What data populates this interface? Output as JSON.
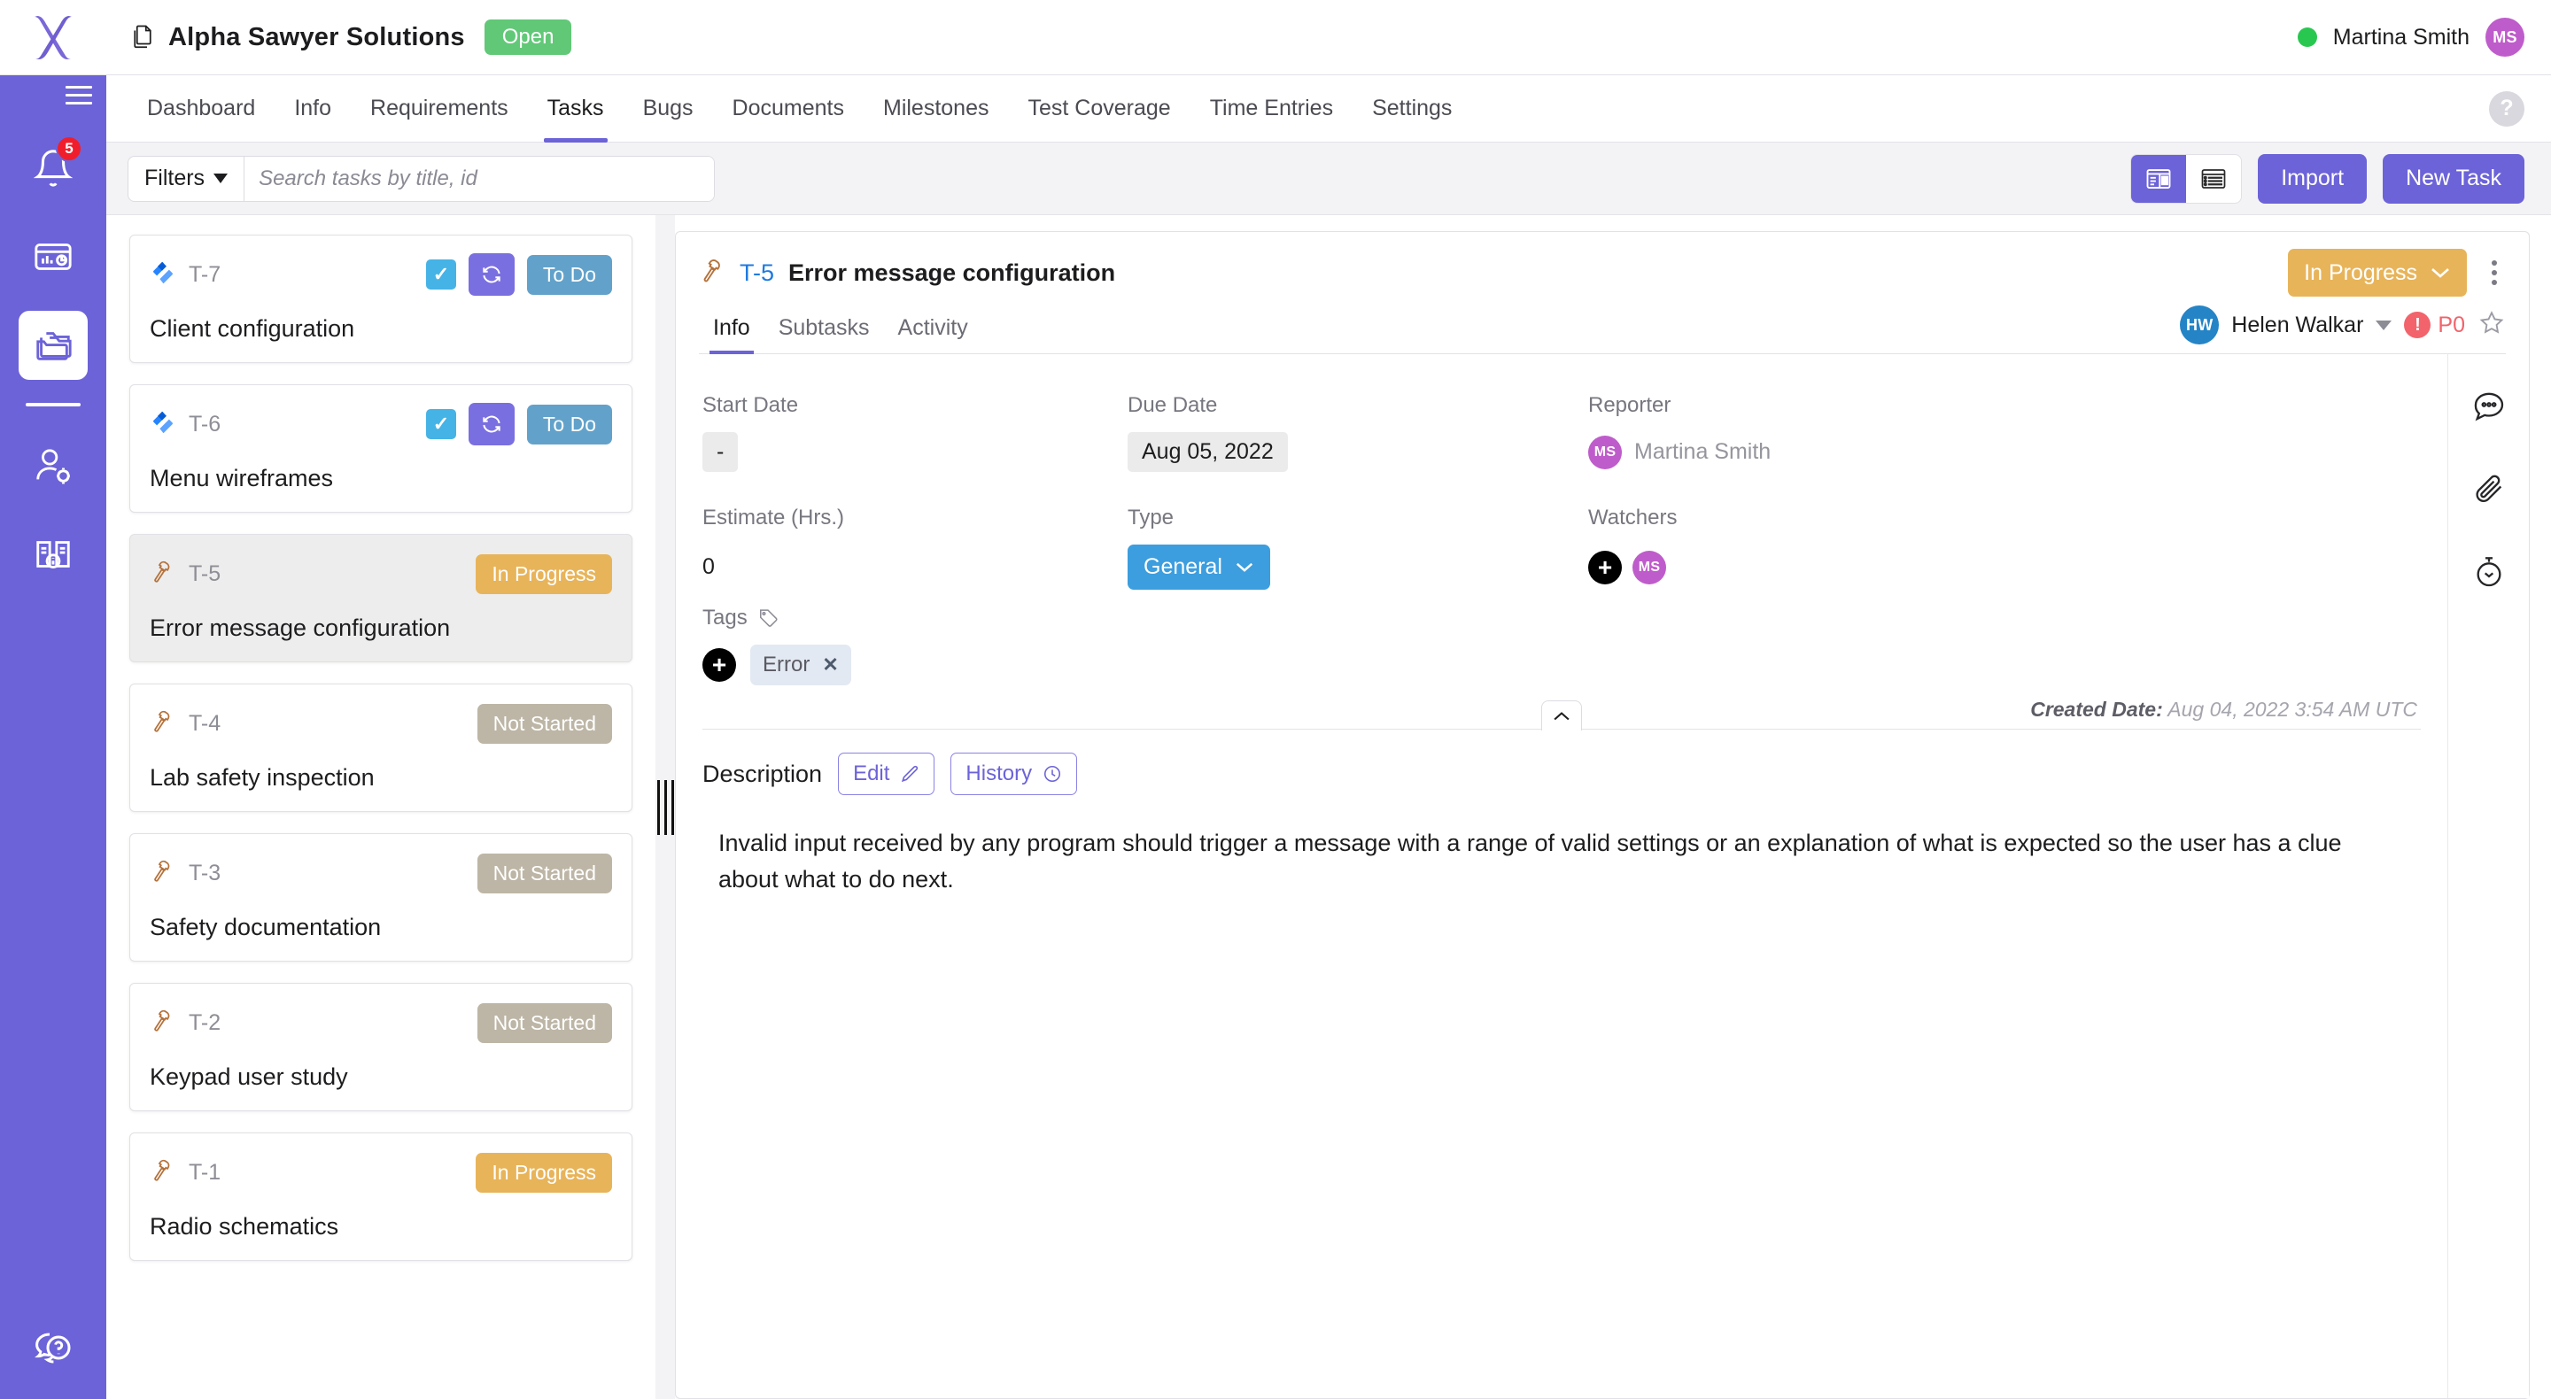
{
  "app": {
    "logo": "x-logo",
    "sidebar": {
      "menu_icon": "hamburger-menu-icon",
      "items": [
        {
          "icon": "bell-icon",
          "name": "notifications",
          "badge": "5"
        },
        {
          "icon": "dashboard-card-icon",
          "name": "analytics"
        },
        {
          "icon": "folders-icon",
          "name": "projects",
          "active": true
        },
        {
          "icon": "user-settings-icon",
          "name": "user-settings"
        },
        {
          "icon": "book-info-icon",
          "name": "knowledge-base"
        }
      ],
      "bottom": {
        "icon": "help-chat-icon",
        "name": "support"
      }
    }
  },
  "topbar": {
    "project_icon": "document-copy-icon",
    "project_title": "Alpha Sawyer Solutions",
    "status_badge": "Open",
    "status_badge_color": "#61c877",
    "presence_color": "#28c850",
    "user_name": "Martina Smith",
    "user_initials": "MS",
    "user_avatar_color": "#bf5ccb"
  },
  "nav": {
    "tabs": [
      {
        "label": "Dashboard",
        "active": false
      },
      {
        "label": "Info",
        "active": false
      },
      {
        "label": "Requirements",
        "active": false
      },
      {
        "label": "Tasks",
        "active": true
      },
      {
        "label": "Bugs",
        "active": false
      },
      {
        "label": "Documents",
        "active": false
      },
      {
        "label": "Milestones",
        "active": false
      },
      {
        "label": "Test Coverage",
        "active": false
      },
      {
        "label": "Time Entries",
        "active": false
      },
      {
        "label": "Settings",
        "active": false
      }
    ],
    "help_label": "?"
  },
  "toolbar": {
    "filters_label": "Filters",
    "search_placeholder": "Search tasks by title, id",
    "search_value": "",
    "view_split_icon": "split-view-icon",
    "view_list_icon": "list-view-icon",
    "import_label": "Import",
    "new_task_label": "New Task",
    "accent_color": "#6c63d8"
  },
  "task_list": [
    {
      "id": "T-7",
      "title": "Client configuration",
      "icon": "jira-icon",
      "checkbox": true,
      "sync": true,
      "status": "To Do",
      "status_style": "pill-todo",
      "selected": false
    },
    {
      "id": "T-6",
      "title": "Menu wireframes",
      "icon": "jira-icon",
      "checkbox": true,
      "sync": true,
      "status": "To Do",
      "status_style": "pill-todo",
      "selected": false
    },
    {
      "id": "T-5",
      "title": "Error message configuration",
      "icon": "hammer-icon",
      "checkbox": false,
      "sync": false,
      "status": "In Progress",
      "status_style": "pill-inprogress",
      "selected": true
    },
    {
      "id": "T-4",
      "title": "Lab safety inspection",
      "icon": "hammer-icon",
      "checkbox": false,
      "sync": false,
      "status": "Not Started",
      "status_style": "pill-notstarted",
      "selected": false
    },
    {
      "id": "T-3",
      "title": "Safety documentation",
      "icon": "hammer-icon",
      "checkbox": false,
      "sync": false,
      "status": "Not Started",
      "status_style": "pill-notstarted",
      "selected": false
    },
    {
      "id": "T-2",
      "title": "Keypad user study",
      "icon": "hammer-icon",
      "checkbox": false,
      "sync": false,
      "status": "Not Started",
      "status_style": "pill-notstarted",
      "selected": false
    },
    {
      "id": "T-1",
      "title": "Radio schematics",
      "icon": "hammer-icon",
      "checkbox": false,
      "sync": false,
      "status": "In Progress",
      "status_style": "pill-inprogress",
      "selected": false
    }
  ],
  "detail": {
    "icon": "hammer-icon",
    "key": "T-5",
    "title": "Error message configuration",
    "status": "In Progress",
    "status_color": "#e8b45a",
    "tabs": [
      {
        "label": "Info",
        "active": true
      },
      {
        "label": "Subtasks",
        "active": false
      },
      {
        "label": "Activity",
        "active": false
      }
    ],
    "assignee_initials": "HW",
    "assignee_name": "Helen Walkar",
    "assignee_avatar_color": "#2484c6",
    "priority": "P0",
    "priority_color": "#f2636b",
    "star_icon": "star-outline-icon",
    "fields": {
      "start_date_label": "Start Date",
      "start_date_value": "-",
      "due_date_label": "Due Date",
      "due_date_value": "Aug 05, 2022",
      "reporter_label": "Reporter",
      "reporter_name": "Martina Smith",
      "reporter_initials": "MS",
      "reporter_avatar_color": "#bf5ccb",
      "estimate_label": "Estimate (Hrs.)",
      "estimate_value": "0",
      "type_label": "Type",
      "type_value": "General",
      "type_color": "#3c9ede",
      "watchers_label": "Watchers",
      "watchers_add": "+",
      "watchers": [
        {
          "initials": "MS",
          "color": "#bf5ccb"
        }
      ],
      "tags_label": "Tags",
      "tags_add": "+",
      "tags": [
        "Error"
      ]
    },
    "created_date_label": "Created Date:",
    "created_date_value": "Aug 04, 2022 3:54 AM UTC",
    "description_label": "Description",
    "edit_label": "Edit",
    "history_label": "History",
    "description_text": "Invalid input received by any program should trigger a message with a range of valid settings or an explanation of what is expected so the user has a clue about what to do next.",
    "rail": [
      {
        "icon": "comment-icon",
        "name": "comments"
      },
      {
        "icon": "paperclip-icon",
        "name": "attachments"
      },
      {
        "icon": "stopwatch-icon",
        "name": "time-tracking"
      }
    ]
  }
}
